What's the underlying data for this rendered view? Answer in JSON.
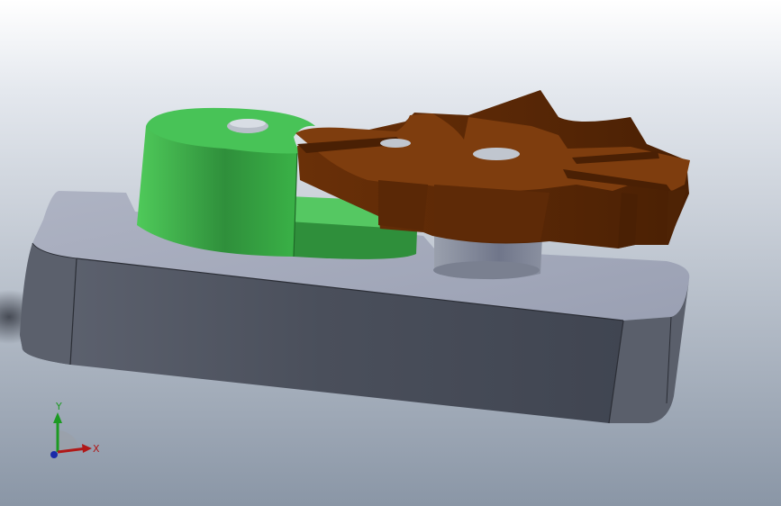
{
  "viewport": {
    "background_top": "#ffffff",
    "background_bottom": "#8c98a8"
  },
  "model": {
    "parts": [
      {
        "name": "base-plate",
        "color": "#4b505c"
      },
      {
        "name": "driving-cam-wheel",
        "color": "#3cb44a"
      },
      {
        "name": "geneva-star-wheel",
        "color": "#7a3a0c"
      },
      {
        "name": "shaft-boss",
        "color": "#7d8390"
      }
    ]
  },
  "triad": {
    "x_label": "X",
    "y_label": "Y",
    "x_color": "#b01818",
    "y_color": "#1c9a22",
    "z_color": "#1a2aa8"
  }
}
